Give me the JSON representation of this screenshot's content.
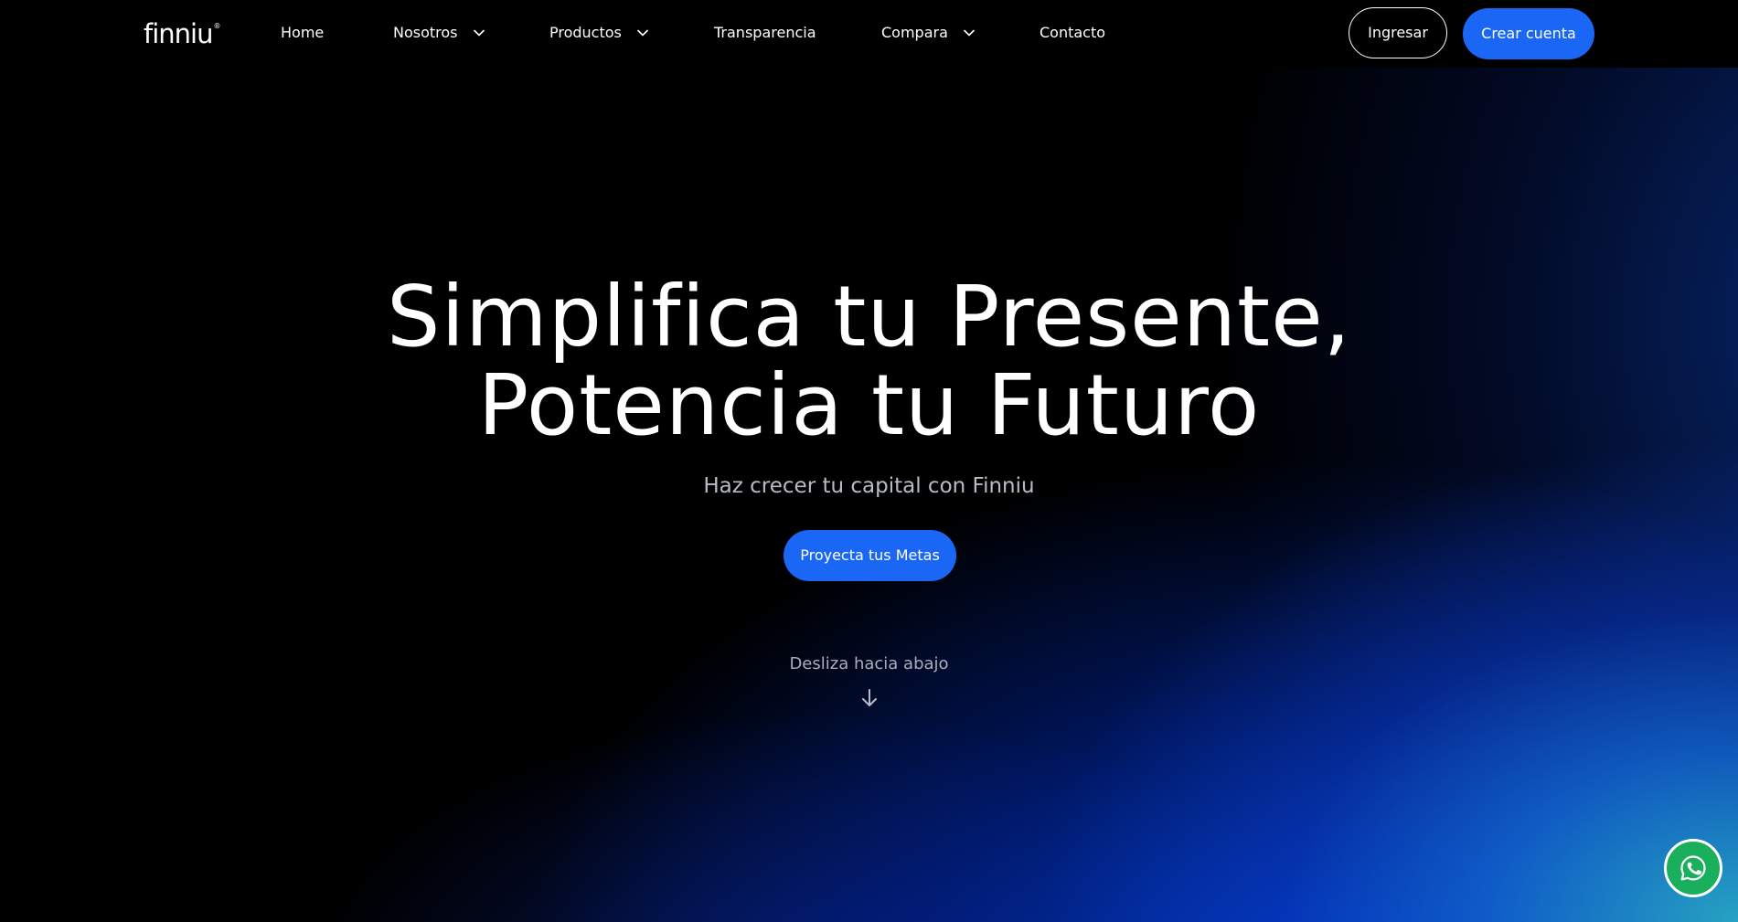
{
  "brand": {
    "logo_text": "finniu",
    "logo_mark": "®"
  },
  "nav": {
    "items": [
      {
        "label": "Home"
      },
      {
        "label": "Nosotros"
      },
      {
        "label": "Productos"
      },
      {
        "label": "Transparencia"
      },
      {
        "label": "Compara"
      },
      {
        "label": "Contacto"
      }
    ],
    "login_label": "Ingresar",
    "signup_label": "Crear cuenta"
  },
  "hero": {
    "title_line1": "Simplifica tu Presente,",
    "title_line2": "Potencia tu Futuro",
    "subtitle": "Haz crecer tu capital con Finniu",
    "cta_label": "Proyecta tus Metas",
    "scroll_hint": "Desliza hacia abajo"
  },
  "icons": {
    "dropdown": "chevron-down-icon",
    "scroll": "arrow-down-icon",
    "chat": "whatsapp-icon"
  },
  "colors": {
    "accent": "#1a66f5",
    "whatsapp": "#1aaf5d",
    "background": "#000000"
  }
}
